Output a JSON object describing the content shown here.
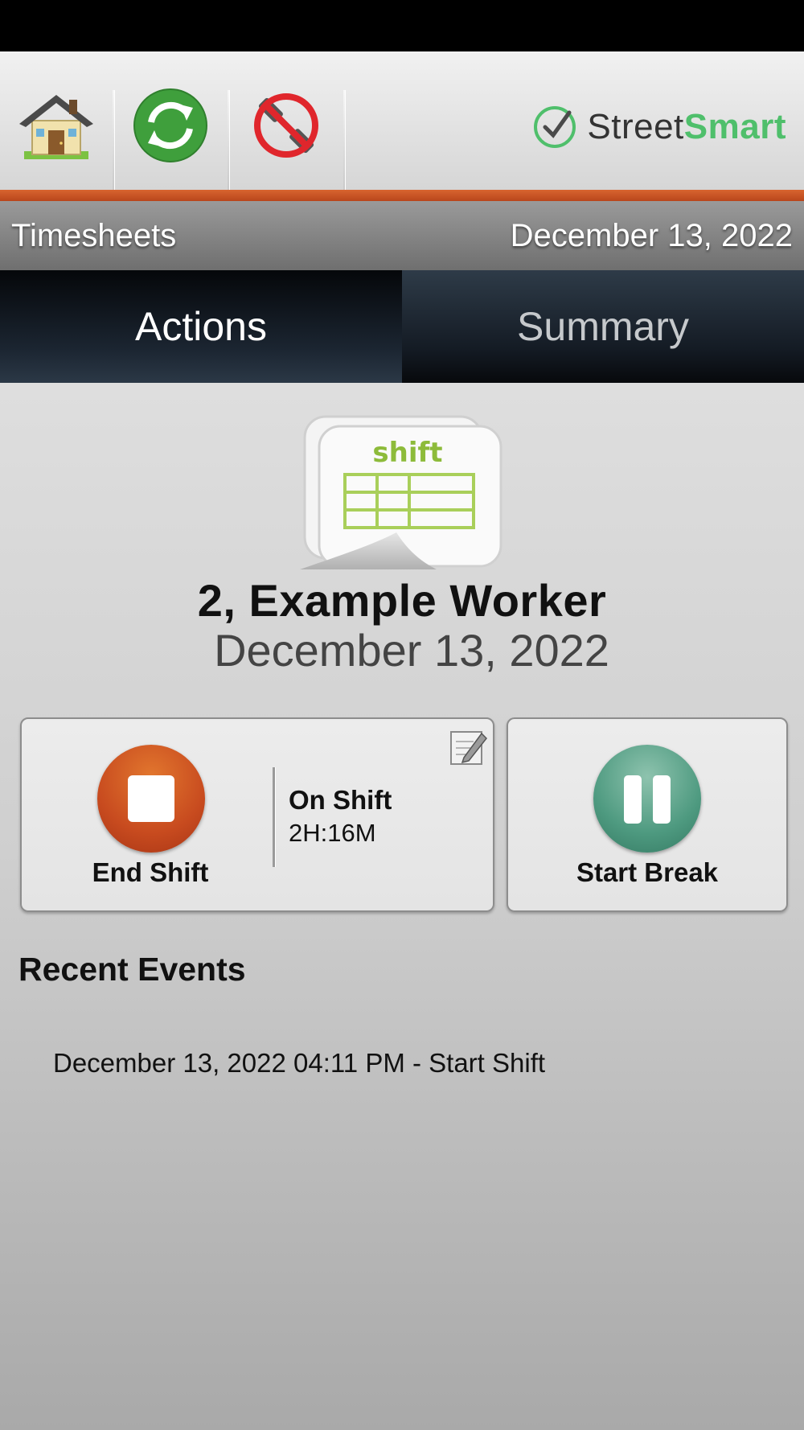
{
  "toolbar": {
    "icons": [
      "home-icon",
      "sync-icon",
      "offline-icon"
    ],
    "brand_part1": "Street",
    "brand_part2": "Smart"
  },
  "titlebar": {
    "title": "Timesheets",
    "date": "December 13, 2022"
  },
  "tabs": [
    {
      "label": "Actions",
      "active": true
    },
    {
      "label": "Summary",
      "active": false
    }
  ],
  "worker": {
    "art_label": "shift",
    "name": "2, Example Worker",
    "date": "December 13, 2022"
  },
  "shift_card": {
    "button_label": "End Shift",
    "status_title": "On Shift",
    "duration": "2H:16M"
  },
  "break_card": {
    "button_label": "Start Break"
  },
  "recent": {
    "title": "Recent Events",
    "events": [
      "December 13, 2022 04:11 PM - Start Shift"
    ]
  },
  "colors": {
    "accent": "#c9562a",
    "brand_green": "#4fbf6b",
    "end_button": "#c84b1f",
    "break_button": "#4e9a80"
  }
}
